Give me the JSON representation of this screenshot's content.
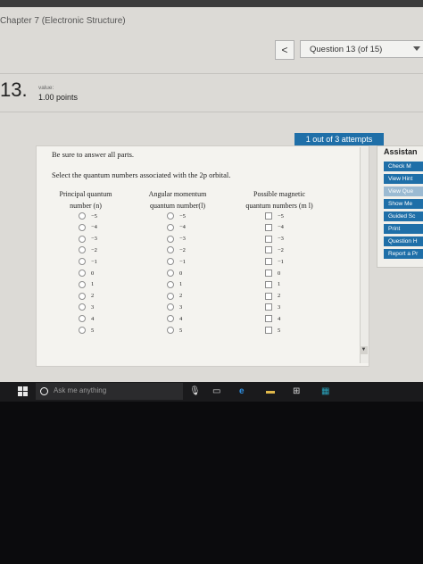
{
  "window": {
    "chapter_title": "Chapter 7 (Electronic Structure)"
  },
  "nav": {
    "prev_symbol": "<",
    "question_select": "Question 13 (of 15)"
  },
  "question": {
    "number": "13.",
    "value_label": "value:",
    "points": "1.00 points",
    "attempts": "1 out of 3 attempts",
    "instruction": "Be sure to answer all parts.",
    "prompt": "Select the quantum numbers associated with the 2p orbital."
  },
  "columns": {
    "principal": {
      "line1": "Principal quantum",
      "line2": "number (n)"
    },
    "angular": {
      "line1": "Angular momentum",
      "line2": "quantum number(l)"
    },
    "magnetic": {
      "line1": "Possible magnetic",
      "line2": "quantum numbers (m l)"
    }
  },
  "options": [
    "−5",
    "−4",
    "−3",
    "−2",
    "−1",
    "0",
    "1",
    "2",
    "3",
    "4",
    "5"
  ],
  "sidebar": {
    "title": "Assistan",
    "buttons": [
      "Check M",
      "View Hint",
      "View Que",
      "Show Me",
      "Guided Sc",
      "Print",
      "Question H",
      "Report a Pr"
    ]
  },
  "taskbar": {
    "search_placeholder": "Ask me anything"
  }
}
